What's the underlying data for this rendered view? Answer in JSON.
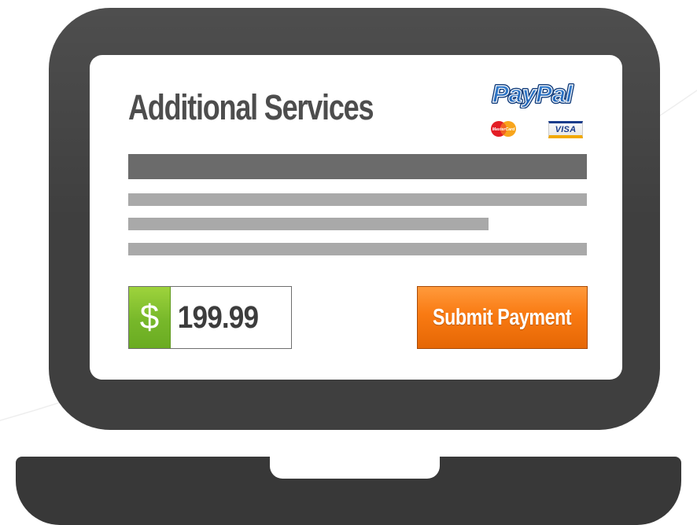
{
  "page": {
    "title": "Additional Services"
  },
  "payment_methods": {
    "paypal": "PayPal",
    "mastercard": "MasterCard",
    "visa": "VISA"
  },
  "amount": {
    "currency_symbol": "$",
    "value": "199.99"
  },
  "actions": {
    "submit_label": "Submit Payment"
  },
  "icons": [
    "paypal-logo",
    "mastercard-icon",
    "visa-icon",
    "dollar-icon"
  ],
  "colors": {
    "laptop_body": "#3f3f3f",
    "laptop_base": "#383838",
    "title_text": "#4d4d4d",
    "placeholder_dark": "#6b6b6b",
    "placeholder_light": "#a9a9a9",
    "currency_green": "#77b82a",
    "submit_orange": "#f97a12"
  }
}
